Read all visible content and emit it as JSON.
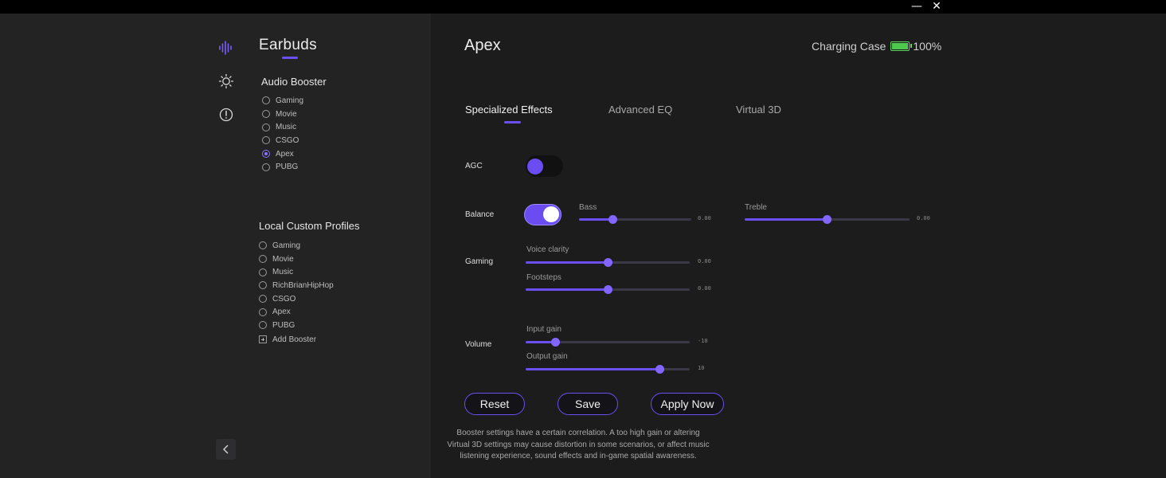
{
  "titlebar": {
    "minimize_glyph": "—",
    "close_glyph": "✕"
  },
  "rail": {
    "icons": [
      "audio-wave-icon",
      "brightness-icon",
      "info-icon"
    ],
    "back_glyph": "chevron-left-icon"
  },
  "sidebar": {
    "title": "Earbuds",
    "audio_booster": {
      "title": "Audio Booster",
      "options": [
        "Gaming",
        "Movie",
        "Music",
        "CSGO",
        "Apex",
        "PUBG"
      ],
      "selected": "Apex"
    },
    "local_profiles": {
      "title": "Local Custom Profiles",
      "options": [
        "Gaming",
        "Movie",
        "Music",
        "RichBrianHipHop",
        "CSGO",
        "Apex",
        "PUBG"
      ],
      "add_label": "Add Booster"
    }
  },
  "main": {
    "title": "Apex",
    "charging": {
      "label": "Charging Case",
      "percent": "100%",
      "level": 1.0
    },
    "tabs": [
      {
        "label": "Specialized Effects",
        "active": true
      },
      {
        "label": "Advanced EQ",
        "active": false
      },
      {
        "label": "Virtual 3D",
        "active": false
      }
    ],
    "agc": {
      "label": "AGC",
      "on": false
    },
    "balance": {
      "label": "Balance",
      "on": true
    },
    "bass": {
      "label": "Bass",
      "value": "0.00",
      "fraction": 0.3
    },
    "treble": {
      "label": "Treble",
      "value": "0.00",
      "fraction": 0.5
    },
    "gaming": {
      "label": "Gaming"
    },
    "voice_clarity": {
      "label": "Voice clarity",
      "value": "0.00",
      "fraction": 0.5
    },
    "footsteps": {
      "label": "Footsteps",
      "value": "0.00",
      "fraction": 0.5
    },
    "volume": {
      "label": "Volume"
    },
    "input_gain": {
      "label": "Input gain",
      "value": "-10",
      "fraction": 0.18
    },
    "output_gain": {
      "label": "Output gain",
      "value": "10",
      "fraction": 0.82
    },
    "buttons": {
      "reset": "Reset",
      "save": "Save",
      "apply": "Apply Now"
    },
    "note": "Booster settings have a certain correlation. A too high gain or altering Virtual 3D settings may cause distortion in some scenarios, or affect music listening experience, sound effects and in-game spatial awareness."
  },
  "colors": {
    "accent": "#6b4ff0",
    "battery": "#4fc84f"
  }
}
